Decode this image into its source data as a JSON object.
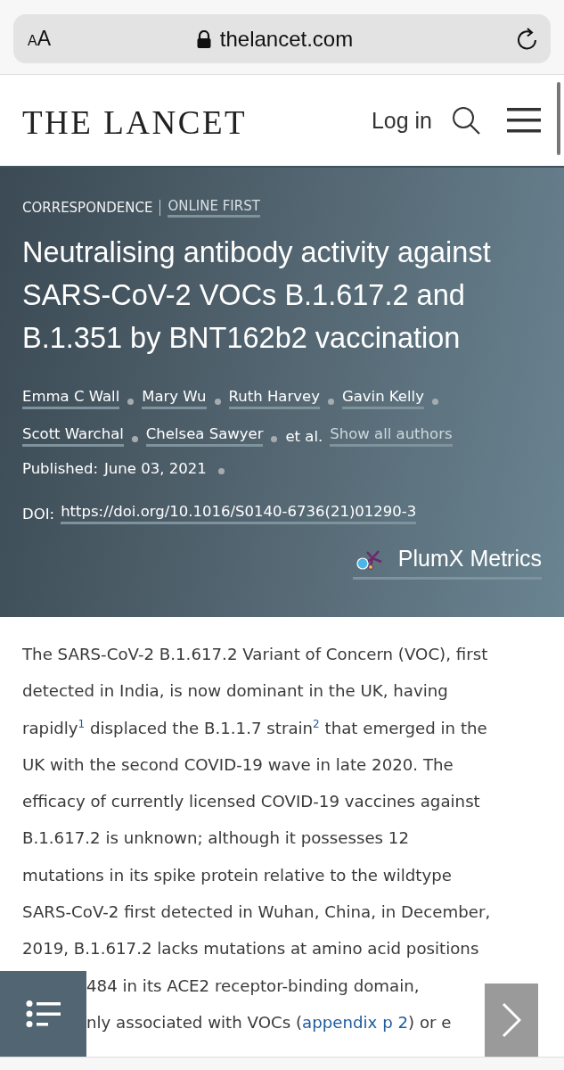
{
  "browser": {
    "text_size_button": "AA",
    "url": "thelancet.com"
  },
  "header": {
    "logo": "THE LANCET",
    "login": "Log in"
  },
  "article": {
    "section": "CORRESPONDENCE",
    "status": "ONLINE FIRST",
    "title": "Neutralising antibody activity against SARS-CoV-2 VOCs B.1.617.2 and B.1.351 by BNT162b2 vaccination",
    "authors": [
      "Emma C Wall",
      "Mary Wu",
      "Ruth Harvey",
      "Gavin Kelly",
      "Scott Warchal",
      "Chelsea Sawyer"
    ],
    "et_al": "et al.",
    "show_all": "Show all authors",
    "published_label": "Published:",
    "published_date": "June 03, 2021",
    "doi_label": "DOI:",
    "doi": "https://doi.org/10.1016/S0140-6736(21)01290-3",
    "plumx": "PlumX Metrics"
  },
  "body": {
    "lines": [
      {
        "kind": "full",
        "parts": [
          {
            "text": "The SARS-CoV-2 B.1.617.2 Variant of Concern (VOC), first",
            "link": false
          }
        ]
      },
      {
        "kind": "full",
        "parts": [
          {
            "text": "detected in India, is now dominant in the UK, having",
            "link": false
          }
        ]
      },
      {
        "kind": "full",
        "parts": [
          {
            "text": "rapidly$^{1}$ displaced the B.1.1.7 strain$^{2}$ that emerged in the",
            "link": false
          }
        ]
      },
      {
        "kind": "full",
        "parts": [
          {
            "text": "UK with the second COVID-19 wave in late 2020. The",
            "link": false
          }
        ]
      },
      {
        "kind": "full",
        "parts": [
          {
            "text": "efficacy of currently licensed COVID-19 vaccines against",
            "link": false
          }
        ]
      },
      {
        "kind": "full",
        "parts": [
          {
            "text": "B.1.617.2 is unknown; although it possesses 12",
            "link": false
          }
        ]
      },
      {
        "kind": "full",
        "parts": [
          {
            "text": "mutations in its spike protein relative to the wildtype",
            "link": false
          }
        ]
      },
      {
        "kind": "full",
        "parts": [
          {
            "text": "SARS-CoV-2 first detected in Wuhan, China, in December,",
            "link": false
          }
        ]
      },
      {
        "kind": "full",
        "parts": [
          {
            "text": "2019, B.1.617.2 lacks mutations at amino acid positions",
            "link": false
          }
        ]
      },
      {
        "kind": "partly_covered",
        "parts": [
          {
            "text": "484 in its ACE2 receptor-binding domain,",
            "link": false
          }
        ]
      },
      {
        "kind": "partly_covered",
        "parts": [
          {
            "text": "nly associated with VOCs (",
            "link": false
          },
          {
            "text": "appendix p 2",
            "link": true
          },
          {
            "text": ") or e",
            "link": false
          }
        ]
      }
    ]
  }
}
